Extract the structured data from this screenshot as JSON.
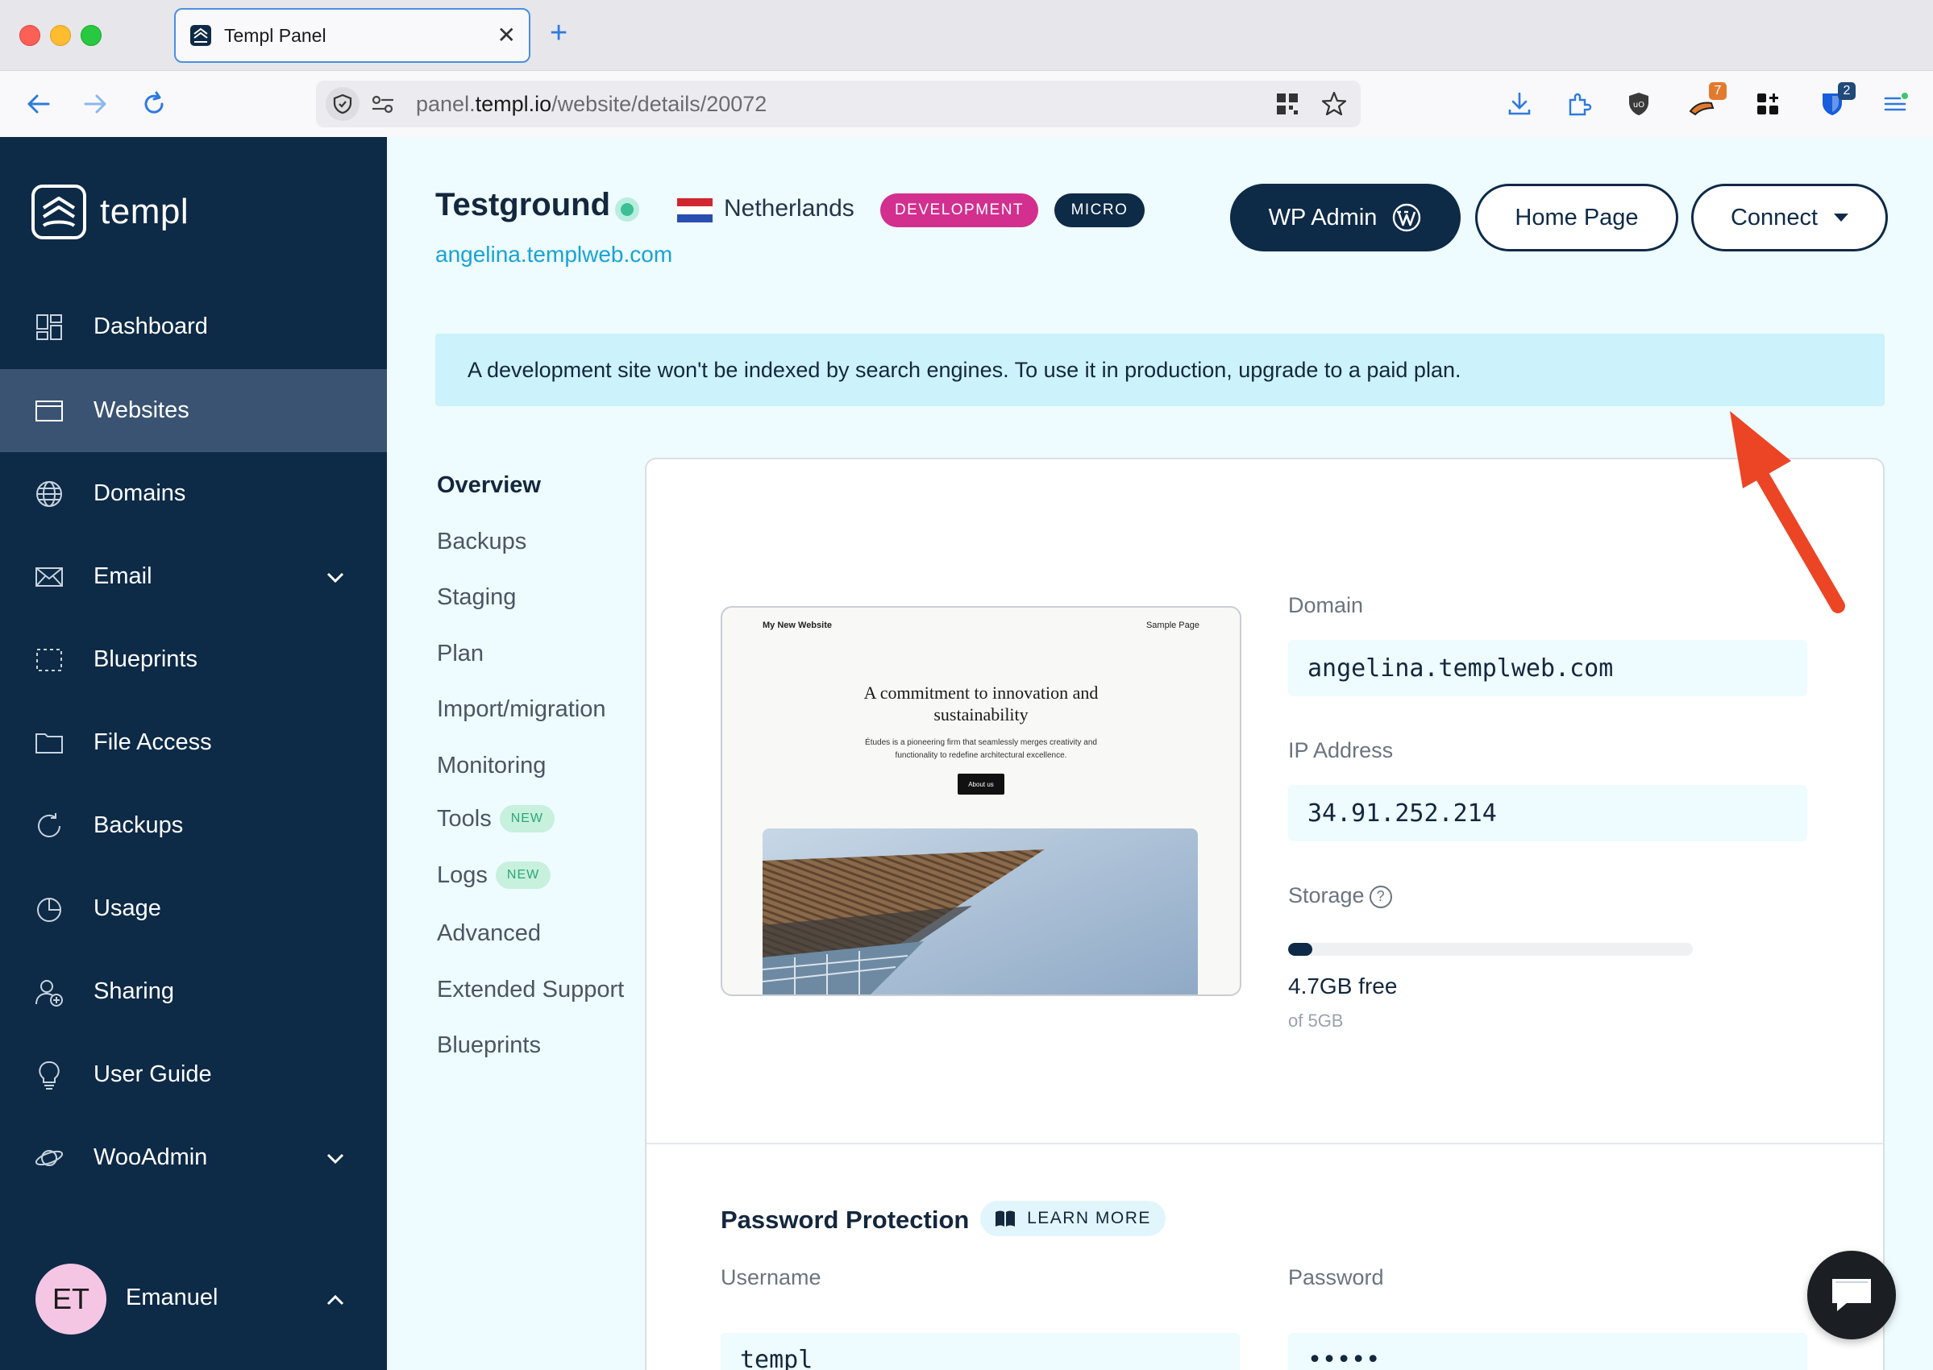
{
  "browser": {
    "tab_title": "Templ Panel",
    "tab_close": "✕",
    "new_tab": "+",
    "url_prefix": "panel.",
    "url_host": "templ.io",
    "url_path": "/website/details/20072",
    "ext_badge_1": "7",
    "ext_badge_2": "2"
  },
  "sidebar": {
    "brand": "templ",
    "items": [
      {
        "label": "Dashboard",
        "icon": "dashboard-icon"
      },
      {
        "label": "Websites",
        "icon": "browser-window-icon",
        "active": true
      },
      {
        "label": "Domains",
        "icon": "globe-icon"
      },
      {
        "label": "Email",
        "icon": "envelope-icon",
        "expandable": true
      },
      {
        "label": "Blueprints",
        "icon": "dashed-square-icon"
      },
      {
        "label": "File Access",
        "icon": "folder-icon"
      },
      {
        "label": "Backups",
        "icon": "refresh-icon"
      },
      {
        "label": "Usage",
        "icon": "pie-chart-icon"
      },
      {
        "label": "Sharing",
        "icon": "user-add-icon"
      },
      {
        "label": "User Guide",
        "icon": "lightbulb-icon"
      },
      {
        "label": "WooAdmin",
        "icon": "planet-icon",
        "expandable": true
      }
    ],
    "user": {
      "initials": "ET",
      "name": "Emanuel"
    }
  },
  "site": {
    "title": "Testground",
    "country": "Netherlands",
    "badge_dev": "DEVELOPMENT",
    "badge_micro": "MICRO",
    "url": "angelina.templweb.com"
  },
  "actions": {
    "wp_admin": "WP Admin",
    "home_page": "Home Page",
    "connect": "Connect"
  },
  "notice": "A development site won't be indexed by search engines. To use it in production, upgrade to a paid plan.",
  "subnav": [
    {
      "label": "Overview",
      "active": true
    },
    {
      "label": "Backups"
    },
    {
      "label": "Staging"
    },
    {
      "label": "Plan"
    },
    {
      "label": "Import/migration"
    },
    {
      "label": "Monitoring"
    },
    {
      "label": "Tools",
      "badge": "NEW"
    },
    {
      "label": "Logs",
      "badge": "NEW"
    },
    {
      "label": "Advanced"
    },
    {
      "label": "Extended Support"
    },
    {
      "label": "Blueprints"
    }
  ],
  "preview": {
    "brand": "My New Website",
    "sample_page": "Sample Page",
    "heading_line1": "A commitment to innovation and",
    "heading_line2": "sustainability",
    "sub_line1": "Études is a pioneering firm that seamlessly merges creativity and",
    "sub_line2": "functionality to redefine architectural excellence.",
    "button": "About us"
  },
  "details": {
    "domain_label": "Domain",
    "domain_value": "angelina.templweb.com",
    "ip_label": "IP Address",
    "ip_value": "34.91.252.214",
    "storage_label": "Storage",
    "storage_help": "?",
    "storage_used_fraction": 0.06,
    "storage_free": "4.7GB free",
    "storage_total": "of 5GB"
  },
  "password_protection": {
    "title": "Password Protection",
    "learn_more": "LEARN MORE",
    "username_label": "Username",
    "username_value": "templ",
    "password_label": "Password",
    "password_value": "•••••"
  },
  "colors": {
    "sidebar_bg": "#0d2a47",
    "sidebar_active": "#3a5372",
    "main_bg": "#eefbff",
    "accent_link": "#17a3d6",
    "badge_dev": "#d22f8f",
    "new_pill": "#c7f0dd",
    "annotation_arrow": "#ec4525"
  }
}
